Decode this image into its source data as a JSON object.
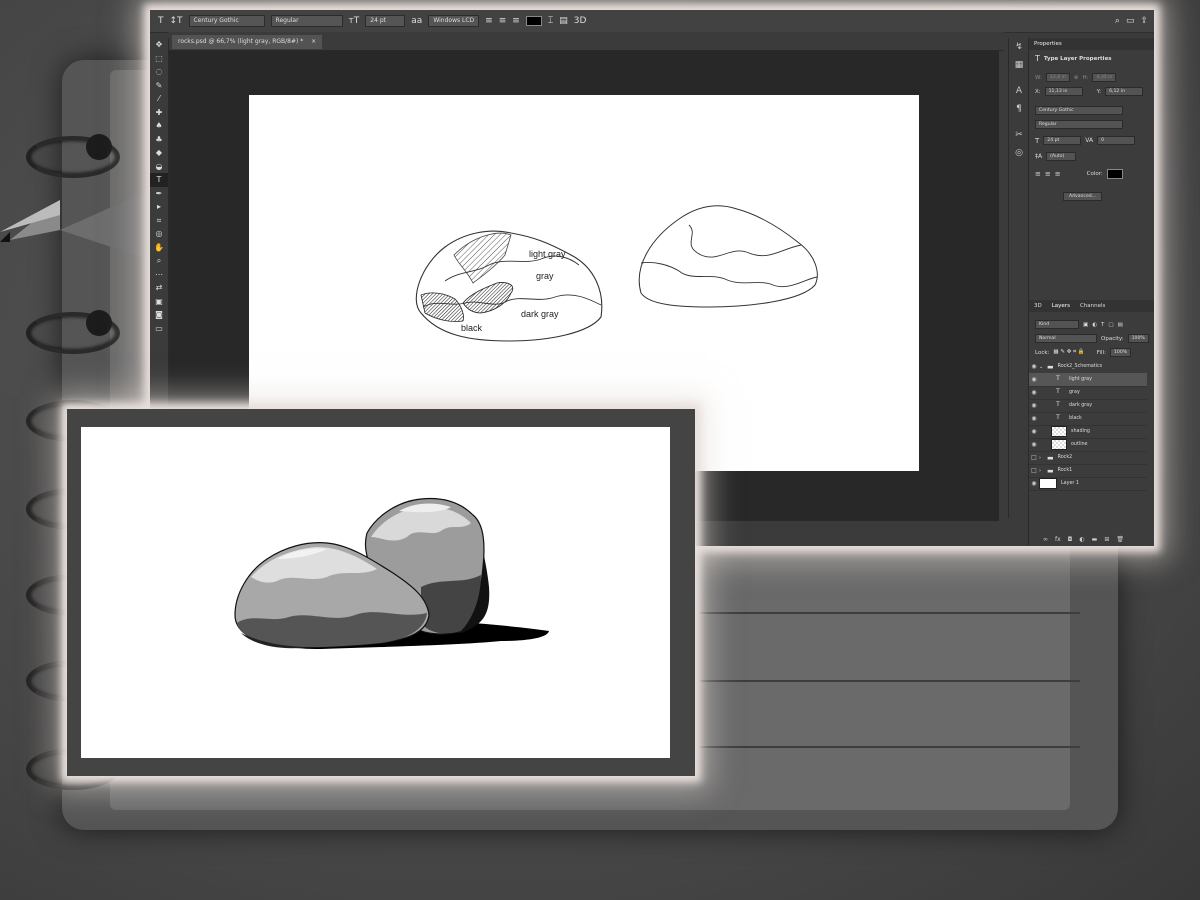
{
  "toolbar_options": {
    "tool_icon": "type-tool-icon",
    "font_family": "Century Gothic",
    "font_style": "Regular",
    "font_size": "24 pt",
    "antialias": "Windows LCD",
    "text_color": "#000000",
    "label_3d": "3D"
  },
  "document_tab": {
    "title": "rocks.psd @ 66,7% (light gray, RGB/8#) *",
    "close": "×"
  },
  "canvas": {
    "labels": {
      "light_gray": "light gray",
      "gray": "gray",
      "dark_gray": "dark gray",
      "black": "black"
    }
  },
  "properties_panel": {
    "tab": "Properties",
    "section_title": "Type Layer Properties",
    "w_label": "W:",
    "w_value": "12,8 in",
    "h_label": "H:",
    "h_value": "4,35 in",
    "x_label": "X:",
    "x_value": "11,13 in",
    "y_label": "Y:",
    "y_value": "6,12 in",
    "font_family": "Century Gothic",
    "font_style": "Regular",
    "font_size": "24 pt",
    "tracking": "0",
    "leading": "(Auto)",
    "color_label": "Color:",
    "advanced_button": "Advanced..."
  },
  "layers_panel": {
    "tabs": [
      "3D",
      "Layers",
      "Channels"
    ],
    "filter": "Kind",
    "blend_mode": "Normal",
    "opacity_label": "Opacity:",
    "opacity_value": "100%",
    "lock_label": "Lock:",
    "fill_label": "Fill:",
    "fill_value": "100%",
    "layers": [
      {
        "name": "Rock2_Schematics",
        "type": "group",
        "visible": true
      },
      {
        "name": "light gray",
        "type": "text",
        "visible": true,
        "active": true
      },
      {
        "name": "gray",
        "type": "text",
        "visible": true
      },
      {
        "name": "dark gray",
        "type": "text",
        "visible": true
      },
      {
        "name": "black",
        "type": "text",
        "visible": true
      },
      {
        "name": "shading",
        "type": "raster",
        "visible": true
      },
      {
        "name": "outline",
        "type": "raster",
        "visible": true
      },
      {
        "name": "Rock2",
        "type": "group",
        "visible": false
      },
      {
        "name": "Rock1",
        "type": "group",
        "visible": false
      },
      {
        "name": "Layer 1",
        "type": "raster-white",
        "visible": true
      }
    ]
  },
  "colors": {
    "ps_bg": "#3b3b3b",
    "canvas_bg": "#282828",
    "glow": "#e9e0dc"
  }
}
